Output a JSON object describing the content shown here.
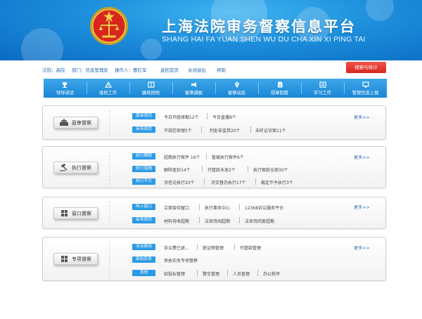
{
  "header": {
    "title_cn": "上海法院审务督察信息平台",
    "title_en": "SHANG HAI FA YUAN SHEN WU DU CHA XIN XI PING TAI",
    "emblem_icon": "court-emblem-icon"
  },
  "info": {
    "court": "法院：高院",
    "dept": "部门：信息管理处",
    "operator": "操作人：曹红军",
    "home": "返回首页",
    "logout": "关闭退出",
    "help": "帮助",
    "search_btn": "搜索与统计"
  },
  "nav": [
    {
      "label": "领导讲话",
      "icon": "speech-icon"
    },
    {
      "label": "维权工作",
      "icon": "rights-icon"
    },
    {
      "label": "廉政园地",
      "icon": "book-icon"
    },
    {
      "label": "督察通报",
      "icon": "announce-icon"
    },
    {
      "label": "督察动态",
      "icon": "location-icon"
    },
    {
      "label": "规章制度",
      "icon": "document-icon"
    },
    {
      "label": "学习工作",
      "icon": "study-icon"
    },
    {
      "label": "管理信息上报",
      "icon": "upload-icon"
    }
  ],
  "cards": [
    {
      "label": "庭审督察",
      "icon": "judge-bench-icon",
      "more": "更多>>",
      "rows": [
        {
          "tag": "庭审观范",
          "items": [
            "今日开庭排期12个",
            "今日直播8个"
          ]
        },
        {
          "tag": "审务规范",
          "items": [
            "不规范审理5个",
            "判处非监禁20个",
            "未听证诉案11个"
          ]
        }
      ]
    },
    {
      "label": "执行督察",
      "icon": "gavel-icon",
      "more": "更多>>",
      "rows": [
        {
          "tag": "执行期限",
          "items": [
            "超期执行案件 16个",
            "暂缓执行案件6个"
          ]
        },
        {
          "tag": "执行措施",
          "items": [
            "解除查封14个",
            "代管款未发2个",
            "执行案款全部30个"
          ]
        },
        {
          "tag": "执行不力",
          "items": [
            "涉信访执行20个",
            "涉交督办执行17个",
            "裁定不予执行3个"
          ]
        }
      ]
    },
    {
      "label": "窗口督察",
      "icon": "window-icon",
      "more": "更多>>",
      "rows": [
        {
          "tag": "网上窗口",
          "items": [
            "立案接待窗口",
            "执行事务中心",
            "12368诉讼服务平台"
          ]
        },
        {
          "tag": "审务规范",
          "items": [
            "材料待收超期",
            "法官待阅超期",
            "法官待回复超期"
          ]
        }
      ]
    },
    {
      "label": "专项督察",
      "icon": "window-icon",
      "more": "更多>>",
      "rows": [
        {
          "tag": "涉诉费用",
          "items": [
            "诉讼费已退...",
            "赃证物管理",
            "代管款管理"
          ]
        },
        {
          "tag": "审执实务",
          "items": [
            "审执实务专项督察"
          ]
        },
        {
          "tag": "其他",
          "items": [
            "招投标管理",
            "警车管理",
            "人员管理",
            "办公秩序"
          ]
        }
      ]
    }
  ],
  "colors": {
    "banner": "#1d8fdc",
    "nav": "#2a95e2",
    "tag": "#2c9ae6",
    "stat_button": "#e23a30",
    "link": "#2a6db3"
  }
}
